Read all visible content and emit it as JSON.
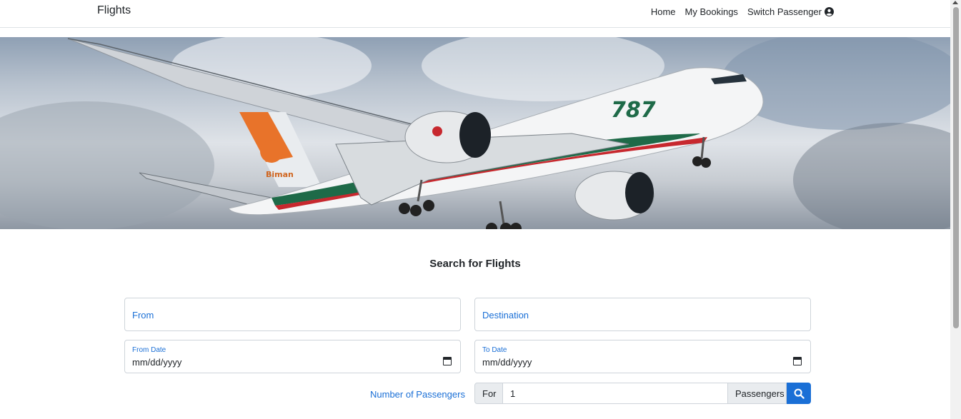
{
  "navbar": {
    "brand": "Flights",
    "links": [
      "Home",
      "My Bookings",
      "Switch Passenger"
    ]
  },
  "hero": {
    "fuselage_text": "787",
    "tail_text": "Biman"
  },
  "search": {
    "title": "Search for Flights",
    "from_label": "From",
    "destination_label": "Destination",
    "from_date_label": "From Date",
    "from_date_value": "mm/dd/yyyy",
    "to_date_label": "To Date",
    "to_date_value": "mm/dd/yyyy",
    "passengers_label": "Number of Passengers",
    "for_label": "For",
    "passengers_value": "1",
    "passengers_suffix": "Passengers"
  },
  "icons": {
    "user": "user-circle-icon",
    "calendar": "calendar-icon",
    "search": "search-icon"
  },
  "colors": {
    "accent": "#1a6fd6"
  }
}
